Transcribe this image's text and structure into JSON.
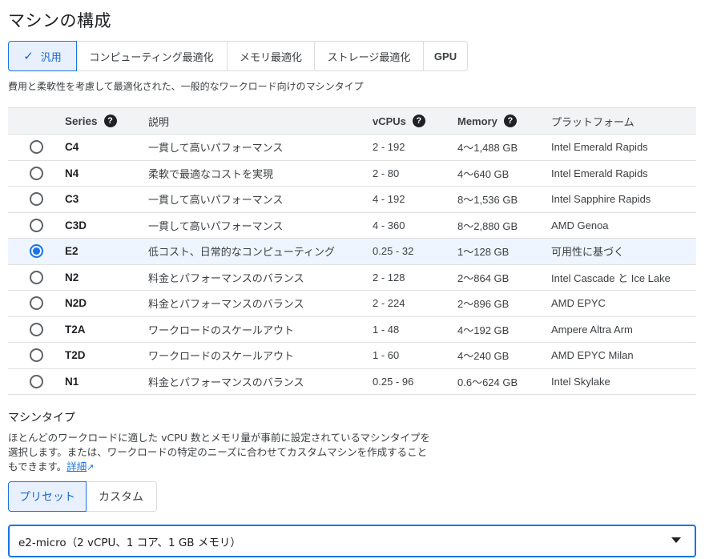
{
  "page_title": "マシンの構成",
  "series_tabs": [
    {
      "label": "汎用",
      "selected": true
    },
    {
      "label": "コンピューティング最適化",
      "selected": false
    },
    {
      "label": "メモリ最適化",
      "selected": false
    },
    {
      "label": "ストレージ最適化",
      "selected": false
    },
    {
      "label": "GPU",
      "selected": false
    }
  ],
  "subtitle": "費用と柔軟性を考慮して最適化された、一般的なワークロード向けのマシンタイプ",
  "table": {
    "headers": {
      "series": "Series",
      "description": "説明",
      "vcpus": "vCPUs",
      "memory": "Memory",
      "platform": "プラットフォーム"
    },
    "help_glyph": "?",
    "rows": [
      {
        "series": "C4",
        "description": "一貫して高いパフォーマンス",
        "vcpus": "2 - 192",
        "memory": "4～1,488 GB",
        "platform": "Intel Emerald Rapids",
        "selected": false
      },
      {
        "series": "N4",
        "description": "柔軟で最適なコストを実現",
        "vcpus": "2 - 80",
        "memory": "4～640 GB",
        "platform": "Intel Emerald Rapids",
        "selected": false
      },
      {
        "series": "C3",
        "description": "一貫して高いパフォーマンス",
        "vcpus": "4 - 192",
        "memory": "8～1,536 GB",
        "platform": "Intel Sapphire Rapids",
        "selected": false
      },
      {
        "series": "C3D",
        "description": "一貫して高いパフォーマンス",
        "vcpus": "4 - 360",
        "memory": "8～2,880 GB",
        "platform": "AMD Genoa",
        "selected": false
      },
      {
        "series": "E2",
        "description": "低コスト、日常的なコンピューティング",
        "vcpus": "0.25 - 32",
        "memory": "1～128 GB",
        "platform": "可用性に基づく",
        "selected": true
      },
      {
        "series": "N2",
        "description": "料金とパフォーマンスのバランス",
        "vcpus": "2 - 128",
        "memory": "2～864 GB",
        "platform": "Intel Cascade と Ice Lake",
        "selected": false
      },
      {
        "series": "N2D",
        "description": "料金とパフォーマンスのバランス",
        "vcpus": "2 - 224",
        "memory": "2～896 GB",
        "platform": "AMD EPYC",
        "selected": false
      },
      {
        "series": "T2A",
        "description": "ワークロードのスケールアウト",
        "vcpus": "1 - 48",
        "memory": "4～192 GB",
        "platform": "Ampere Altra Arm",
        "selected": false
      },
      {
        "series": "T2D",
        "description": "ワークロードのスケールアウト",
        "vcpus": "1 - 60",
        "memory": "4～240 GB",
        "platform": "AMD EPYC Milan",
        "selected": false
      },
      {
        "series": "N1",
        "description": "料金とパフォーマンスのバランス",
        "vcpus": "0.25 - 96",
        "memory": "0.6～624 GB",
        "platform": "Intel Skylake",
        "selected": false
      }
    ]
  },
  "machine_type": {
    "title": "マシンタイプ",
    "description_line1": "ほとんどのワークロードに適した vCPU 数とメモリ量が事前に設定されているマシンタイプを",
    "description_line2": "選択します。または、ワークロードの特定のニーズに合わせてカスタムマシンを作成すること",
    "description_line3": "もできます。",
    "link_label": "詳細",
    "toggle": [
      {
        "label": "プリセット",
        "selected": true
      },
      {
        "label": "カスタム",
        "selected": false
      }
    ],
    "selected_value": "e2-micro（2 vCPU、1 コア、1 GB メモリ）"
  },
  "colors": {
    "accent": "#1a73e8",
    "selected_bg": "#e8f0fe",
    "header_bg": "#f1f3f4"
  }
}
